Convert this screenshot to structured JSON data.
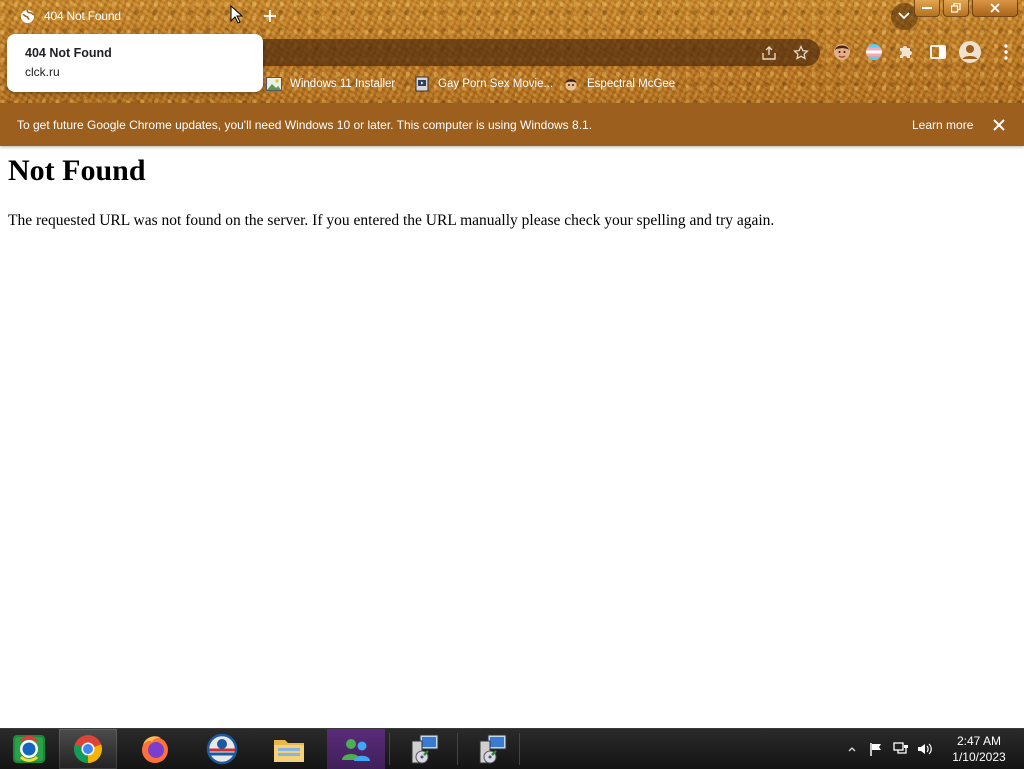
{
  "browser": {
    "tab_title": "404 Not Found",
    "hover_card": {
      "title": "404 Not Found",
      "domain": "clck.ru"
    },
    "bookmarks": [
      {
        "label": "Windows 11 Installer"
      },
      {
        "label": "Gay Porn Sex Movie..."
      },
      {
        "label": "Espectral McGee"
      }
    ],
    "infobar": {
      "message": "To get future Google Chrome updates, you'll need Windows 10 or later. This computer is using Windows 8.1.",
      "link": "Learn more"
    },
    "theme_color": "#b87523"
  },
  "page": {
    "heading": "Not Found",
    "body": "The requested URL was not found on the server. If you entered the URL manually please check your spelling and try again."
  },
  "taskbar": {
    "apps": [
      "start-icon",
      "chrome-icon",
      "firefox-icon",
      "opera-icon",
      "file-explorer-icon",
      "messenger-icon",
      "installer-icon",
      "installer-icon"
    ],
    "clock": {
      "time": "2:47 AM",
      "date": "1/10/2023"
    }
  }
}
